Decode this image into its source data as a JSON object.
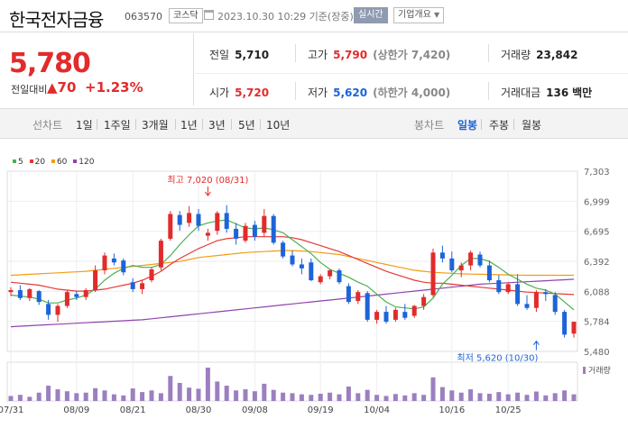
{
  "header": {
    "title": "한국전자금융",
    "code": "063570",
    "market": "코스닥",
    "datetime": "2023.10.30 10:29 기준(장중)",
    "live_label": "실시간",
    "info_label": "기업개요"
  },
  "price": {
    "current": "5,780",
    "change_label": "전일대비",
    "change_value": "70",
    "change_pct": "+1.23%",
    "up_color": "#e22b2b",
    "down_color": "#1d64d9"
  },
  "stats": {
    "prev_close_label": "전일",
    "prev_close": "5,710",
    "high_label": "고가",
    "high": "5,790",
    "upper_limit": "(상한가 7,420)",
    "volume_label": "거래량",
    "volume": "23,842",
    "open_label": "시가",
    "open": "5,720",
    "low_label": "저가",
    "low": "5,620",
    "lower_limit": "(하한가 4,000)",
    "value_label": "거래대금",
    "value": "136",
    "value_unit": "백만"
  },
  "tabs": {
    "line_label": "선차트",
    "line_items": [
      "1일",
      "1주일",
      "3개월",
      "1년",
      "3년",
      "5년",
      "10년"
    ],
    "candle_label": "봉차트",
    "candle_items": [
      "일봉",
      "주봉",
      "월봉"
    ],
    "candle_active": "일봉"
  },
  "chart_data": {
    "type": "candlestick",
    "legend": [
      {
        "name": "5",
        "color": "#4caf50"
      },
      {
        "name": "20",
        "color": "#e53935"
      },
      {
        "name": "60",
        "color": "#f39c12"
      },
      {
        "name": "120",
        "color": "#8e44ad"
      }
    ],
    "y_ticks": [
      7303,
      6999,
      6695,
      6392,
      6088,
      5784,
      5480
    ],
    "ylim": [
      5480,
      7303
    ],
    "x_ticks": [
      "07/31",
      "08/09",
      "08/21",
      "08/30",
      "09/08",
      "09/19",
      "10/04",
      "10/16",
      "10/25"
    ],
    "x_tick_index": [
      0,
      7,
      13,
      20,
      26,
      33,
      39,
      47,
      53
    ],
    "high_label": "최고 7,020 (08/31)",
    "high_index": 21,
    "high_value": 7020,
    "low_label": "최저 5,620 (10/30)",
    "low_index": 56,
    "low_value": 5620,
    "volume_label": "거래량",
    "candles": [
      [
        6080,
        6130,
        6040,
        6100
      ],
      [
        6100,
        6150,
        6000,
        6020
      ],
      [
        6020,
        6120,
        5990,
        6110
      ],
      [
        6090,
        6100,
        5950,
        5980
      ],
      [
        5960,
        6000,
        5800,
        5850
      ],
      [
        5850,
        5960,
        5780,
        5940
      ],
      [
        5940,
        6100,
        5920,
        6080
      ],
      [
        6060,
        6090,
        6000,
        6030
      ],
      [
        6030,
        6120,
        6000,
        6100
      ],
      [
        6100,
        6350,
        6080,
        6300
      ],
      [
        6300,
        6480,
        6260,
        6450
      ],
      [
        6420,
        6470,
        6350,
        6380
      ],
      [
        6400,
        6420,
        6250,
        6280
      ],
      [
        6180,
        6220,
        6080,
        6110
      ],
      [
        6110,
        6200,
        6060,
        6170
      ],
      [
        6200,
        6330,
        6180,
        6310
      ],
      [
        6330,
        6620,
        6300,
        6600
      ],
      [
        6620,
        6900,
        6600,
        6870
      ],
      [
        6860,
        6900,
        6700,
        6760
      ],
      [
        6780,
        6950,
        6740,
        6880
      ],
      [
        6870,
        6920,
        6700,
        6750
      ],
      [
        6650,
        6720,
        6600,
        6680
      ],
      [
        6700,
        6900,
        6660,
        6880
      ],
      [
        6880,
        6960,
        6680,
        6720
      ],
      [
        6720,
        6780,
        6560,
        6620
      ],
      [
        6600,
        6780,
        6580,
        6750
      ],
      [
        6760,
        6800,
        6600,
        6640
      ],
      [
        6680,
        6920,
        6640,
        6850
      ],
      [
        6850,
        6870,
        6560,
        6580
      ],
      [
        6580,
        6600,
        6420,
        6440
      ],
      [
        6450,
        6500,
        6340,
        6360
      ],
      [
        6360,
        6420,
        6260,
        6320
      ],
      [
        6380,
        6420,
        6190,
        6200
      ],
      [
        6180,
        6260,
        6160,
        6240
      ],
      [
        6240,
        6310,
        6210,
        6300
      ],
      [
        6300,
        6320,
        6160,
        6180
      ],
      [
        6140,
        6170,
        5960,
        5980
      ],
      [
        5990,
        6100,
        5960,
        6080
      ],
      [
        6070,
        6090,
        5780,
        5800
      ],
      [
        5800,
        5900,
        5760,
        5880
      ],
      [
        5880,
        5940,
        5760,
        5780
      ],
      [
        5800,
        5920,
        5780,
        5900
      ],
      [
        5880,
        5960,
        5800,
        5820
      ],
      [
        5840,
        5950,
        5820,
        5940
      ],
      [
        5940,
        6060,
        5900,
        6030
      ],
      [
        6050,
        6520,
        6030,
        6480
      ],
      [
        6480,
        6550,
        6380,
        6420
      ],
      [
        6420,
        6490,
        6280,
        6300
      ],
      [
        6300,
        6380,
        6230,
        6350
      ],
      [
        6350,
        6500,
        6300,
        6480
      ],
      [
        6460,
        6490,
        6330,
        6350
      ],
      [
        6350,
        6400,
        6180,
        6200
      ],
      [
        6200,
        6250,
        6060,
        6080
      ],
      [
        6080,
        6180,
        6060,
        6160
      ],
      [
        6160,
        6260,
        5940,
        5960
      ],
      [
        5960,
        6050,
        5900,
        5920
      ],
      [
        5920,
        6100,
        5880,
        6080
      ],
      [
        6080,
        6110,
        5990,
        6060
      ],
      [
        6050,
        6080,
        5850,
        5880
      ],
      [
        5880,
        5900,
        5620,
        5650
      ],
      [
        5660,
        5780,
        5620,
        5780
      ]
    ],
    "volume": [
      18,
      22,
      15,
      30,
      55,
      42,
      35,
      28,
      30,
      46,
      38,
      24,
      20,
      45,
      32,
      38,
      28,
      90,
      65,
      48,
      44,
      120,
      70,
      55,
      38,
      42,
      35,
      62,
      40,
      30,
      28,
      24,
      22,
      26,
      30,
      24,
      52,
      28,
      40,
      22,
      18,
      25,
      20,
      28,
      22,
      85,
      50,
      38,
      30,
      42,
      28,
      26,
      32,
      24,
      30,
      22,
      34,
      20,
      28,
      38,
      24
    ],
    "ma5": [
      6050,
      6040,
      6030,
      6010,
      5970,
      5970,
      6000,
      6020,
      6050,
      6110,
      6200,
      6270,
      6320,
      6350,
      6330,
      6330,
      6360,
      6450,
      6560,
      6660,
      6750,
      6780,
      6800,
      6810,
      6770,
      6730,
      6720,
      6730,
      6710,
      6680,
      6610,
      6540,
      6470,
      6380,
      6310,
      6270,
      6230,
      6180,
      6140,
      6060,
      5980,
      5930,
      5920,
      5910,
      5930,
      6020,
      6160,
      6250,
      6350,
      6420,
      6420,
      6390,
      6330,
      6260,
      6210,
      6160,
      6120,
      6100,
      6060,
      5980,
      5900
    ],
    "ma20": [
      6180,
      6170,
      6160,
      6150,
      6130,
      6110,
      6100,
      6090,
      6090,
      6100,
      6110,
      6130,
      6150,
      6170,
      6200,
      6240,
      6290,
      6360,
      6420,
      6470,
      6520,
      6560,
      6600,
      6620,
      6630,
      6640,
      6640,
      6640,
      6640,
      6640,
      6630,
      6610,
      6580,
      6550,
      6520,
      6490,
      6450,
      6410,
      6370,
      6330,
      6290,
      6260,
      6230,
      6200,
      6180,
      6170,
      6170,
      6160,
      6150,
      6140,
      6130,
      6120,
      6110,
      6100,
      6090,
      6080,
      6075,
      6070,
      6065,
      6060,
      6055
    ],
    "ma60": [
      6250,
      6255,
      6260,
      6265,
      6270,
      6275,
      6280,
      6285,
      6290,
      6300,
      6310,
      6320,
      6330,
      6340,
      6350,
      6360,
      6370,
      6380,
      6390,
      6410,
      6430,
      6440,
      6450,
      6460,
      6470,
      6480,
      6485,
      6490,
      6495,
      6500,
      6500,
      6495,
      6490,
      6480,
      6470,
      6460,
      6440,
      6420,
      6400,
      6380,
      6360,
      6340,
      6320,
      6300,
      6290,
      6280,
      6275,
      6270,
      6265,
      6262,
      6260,
      6258,
      6256,
      6254,
      6252,
      6250,
      6250,
      6250,
      6250,
      6250,
      6250
    ],
    "ma120": [
      5730,
      5735,
      5740,
      5745,
      5750,
      5755,
      5760,
      5765,
      5770,
      5775,
      5780,
      5785,
      5790,
      5795,
      5800,
      5810,
      5820,
      5830,
      5840,
      5850,
      5860,
      5870,
      5880,
      5890,
      5900,
      5910,
      5920,
      5930,
      5940,
      5950,
      5960,
      5970,
      5980,
      5990,
      6000,
      6010,
      6020,
      6030,
      6040,
      6050,
      6060,
      6070,
      6080,
      6090,
      6100,
      6110,
      6120,
      6130,
      6140,
      6150,
      6160,
      6165,
      6170,
      6175,
      6180,
      6185,
      6190,
      6195,
      6200,
      6205,
      6210
    ]
  }
}
